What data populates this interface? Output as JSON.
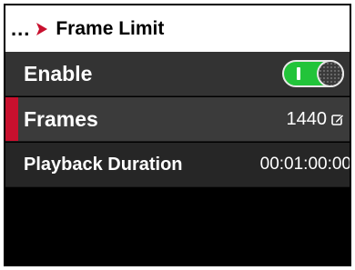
{
  "header": {
    "breadcrumb_dots": "...",
    "title": "Frame Limit"
  },
  "rows": [
    {
      "label": "Enable",
      "value_type": "toggle",
      "toggle_on": true
    },
    {
      "label": "Frames",
      "value": "1440",
      "selected": true
    },
    {
      "label": "Playback Duration",
      "value": "00:01:00:00"
    }
  ],
  "colors": {
    "accent_red": "#c8102e",
    "toggle_green": "#22c43a"
  }
}
